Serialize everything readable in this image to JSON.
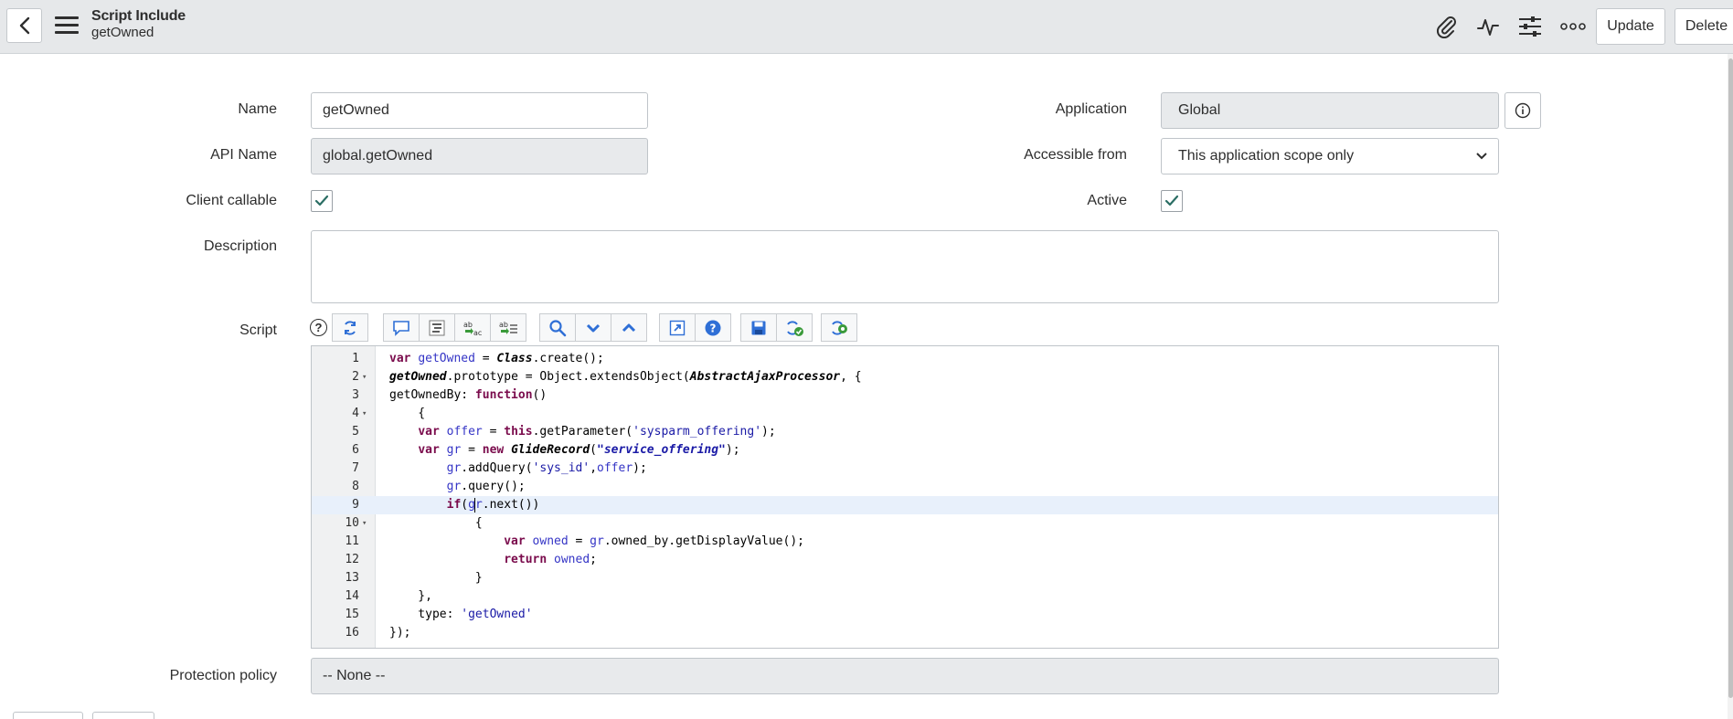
{
  "header": {
    "title": "Script Include",
    "subtitle": "getOwned",
    "buttons": {
      "update": "Update",
      "delete": "Delete"
    },
    "icons": [
      "back-icon",
      "menu-icon",
      "attachment-icon",
      "activity-icon",
      "settings-sliders-icon",
      "more-icon"
    ]
  },
  "form": {
    "name": {
      "label": "Name",
      "value": "getOwned"
    },
    "api_name": {
      "label": "API Name",
      "value": "global.getOwned"
    },
    "client_callable": {
      "label": "Client callable",
      "checked": true
    },
    "description": {
      "label": "Description",
      "value": ""
    },
    "application": {
      "label": "Application",
      "value": "Global"
    },
    "accessible_from": {
      "label": "Accessible from",
      "value": "This application scope only"
    },
    "active": {
      "label": "Active",
      "checked": true
    },
    "script": {
      "label": "Script",
      "help": "?"
    },
    "protection_policy": {
      "label": "Protection policy",
      "value": "-- None --"
    }
  },
  "editor": {
    "active_line": 9,
    "fold_lines": [
      2,
      4,
      10
    ],
    "line_numbers": [
      "1",
      "2",
      "3",
      "4",
      "5",
      "6",
      "7",
      "8",
      "9",
      "10",
      "11",
      "12",
      "13",
      "14",
      "15",
      "16"
    ],
    "lines": [
      "var getOwned = Class.create();",
      "getOwned.prototype = Object.extendsObject(AbstractAjaxProcessor, {",
      "getOwnedBy: function()",
      "    {",
      "    var offer = this.getParameter('sysparm_offering');",
      "    var gr = new GlideRecord(\"service_offering\");",
      "        gr.addQuery('sys_id',offer);",
      "        gr.query();",
      "        if(gr.next())",
      "            {",
      "                var owned = gr.owned_by.getDisplayValue();",
      "                return owned;",
      "            }",
      "    },",
      "    type: 'getOwned'",
      "});"
    ]
  },
  "colors": {
    "header_bg": "#e6e8ea",
    "check": "#2b6e64",
    "keyword": "#7a0b4c",
    "variable": "#3535c6",
    "string": "#1a1aa6"
  }
}
